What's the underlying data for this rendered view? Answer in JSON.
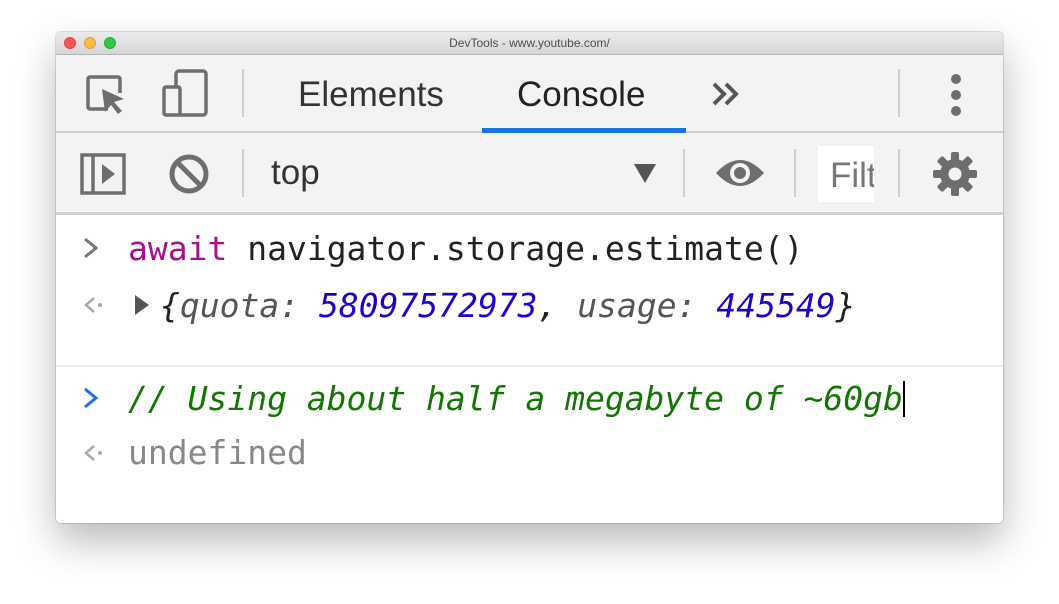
{
  "window": {
    "title": "DevTools - www.youtube.com/"
  },
  "tabs": [
    {
      "label": "Elements"
    },
    {
      "label": "Console"
    }
  ],
  "toolbar": {
    "context_value": "top",
    "filter_placeholder": "Filter"
  },
  "console": {
    "entries": [
      {
        "kind": "input",
        "keyword": "await",
        "text": "navigator.storage.estimate()"
      },
      {
        "kind": "result",
        "open_brace": "{",
        "quota_key": "quota:",
        "quota_value": "58097572973",
        "comma": ",",
        "usage_key": "usage:",
        "usage_value": "445549",
        "close_brace": "}"
      },
      {
        "kind": "input",
        "text": "// Using about half a megabyte of ~60gb"
      },
      {
        "kind": "result",
        "text": "undefined"
      }
    ]
  },
  "icons": {
    "inspect": "inspect-element-icon",
    "device": "device-toolbar-icon",
    "more_tabs": "chevron-double-right-icon",
    "menu": "more-vertical-icon",
    "sidebar": "sidebar-toggle-icon",
    "clear": "clear-console-icon",
    "eye": "eye-icon",
    "settings": "gear-icon"
  },
  "colors": {
    "accent": "#1a73e8",
    "keyword": "#aa0d91",
    "number": "#1c00cf",
    "comment": "#117700"
  }
}
